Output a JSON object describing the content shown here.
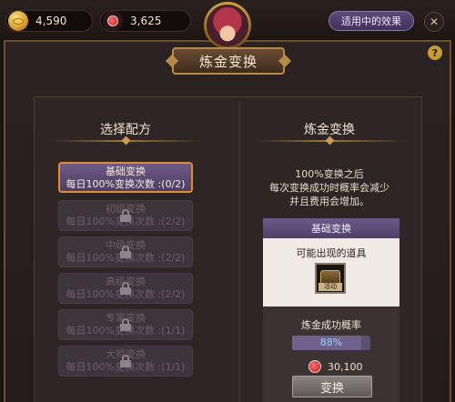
{
  "resources": {
    "gold": "4,590",
    "potion": "3,625"
  },
  "header": {
    "effects_button": "适用中的效果",
    "close_icon": "✕",
    "title": "炼金变换",
    "help_icon": "?"
  },
  "left": {
    "title": "选择配方",
    "recipes": [
      {
        "name": "基础变换",
        "count": "每日100%变换次数 :(0/2)",
        "locked": false
      },
      {
        "name": "初级变换",
        "count": "每日100%变换次数 :(2/2)",
        "locked": true
      },
      {
        "name": "中级变换",
        "count": "每日100%变换次数 :(2/2)",
        "locked": true
      },
      {
        "name": "高级变换",
        "count": "每日100%变换次数 :(2/2)",
        "locked": true
      },
      {
        "name": "专家变换",
        "count": "每日100%变换次数 :(1/1)",
        "locked": true
      },
      {
        "name": "大师变换",
        "count": "每日100%变换次数 :(1/1)",
        "locked": true
      }
    ]
  },
  "right": {
    "title": "炼金变换",
    "desc": [
      "100%变换之后",
      "每次变换成功时概率会减少",
      "并且费用会增加。"
    ],
    "card_title": "基础变换",
    "possible_items": "可能出现的道具",
    "item_tag": "活动",
    "rate_label": "炼金成功概率",
    "rate": "88%",
    "rate_value": 0.88,
    "cost": "30,100",
    "convert_button": "变换"
  }
}
